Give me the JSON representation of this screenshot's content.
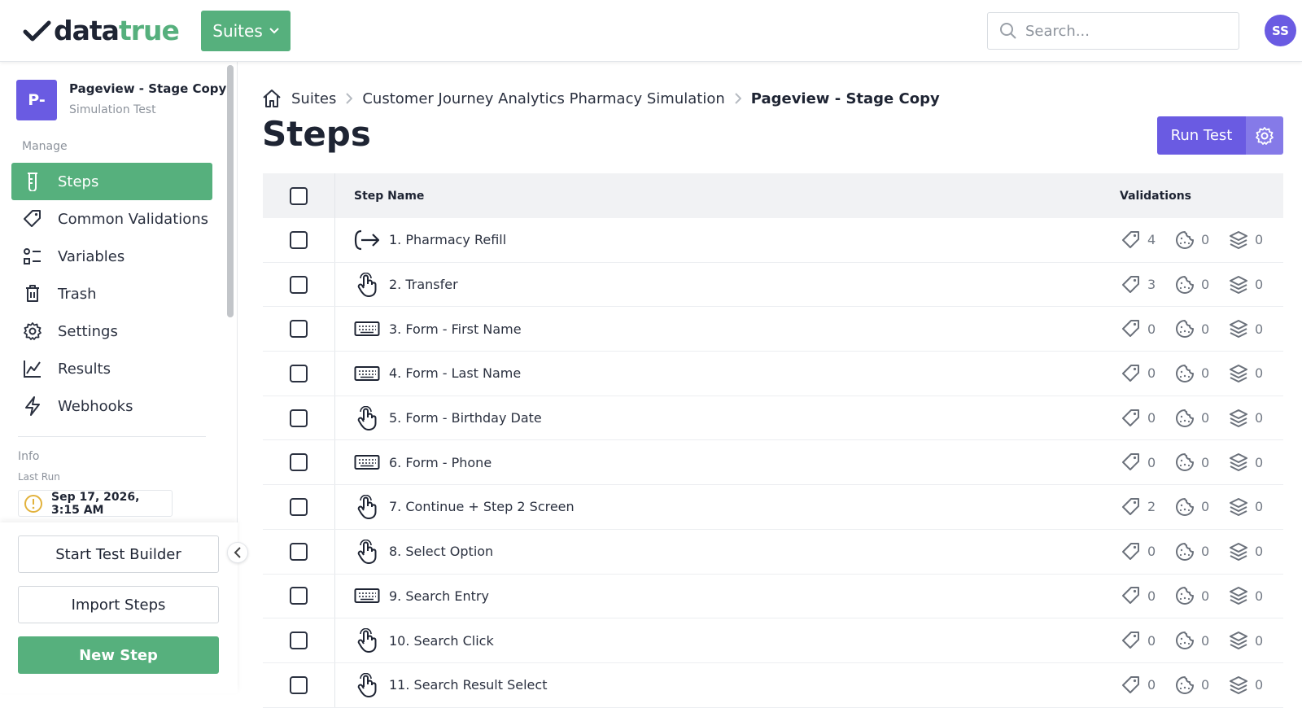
{
  "header": {
    "logo_left": "data",
    "logo_right": "true",
    "suites_label": "Suites",
    "search_placeholder": "Search...",
    "user_initials": "SS"
  },
  "sidebar": {
    "tile": "P-",
    "test_name": "Pageview - Stage Copy",
    "test_type": "Simulation Test",
    "section_label": "Manage",
    "items": [
      {
        "label": "Steps",
        "icon": "beaker-icon",
        "active": true
      },
      {
        "label": "Common Validations",
        "icon": "tag-icon",
        "active": false
      },
      {
        "label": "Variables",
        "icon": "variables-icon",
        "active": false
      },
      {
        "label": "Trash",
        "icon": "trash-icon",
        "active": false
      },
      {
        "label": "Settings",
        "icon": "gear-icon",
        "active": false
      },
      {
        "label": "Results",
        "icon": "chart-icon",
        "active": false
      },
      {
        "label": "Webhooks",
        "icon": "bolt-icon",
        "active": false
      }
    ],
    "info_label": "Info",
    "last_run_label": "Last Run",
    "last_run_value": "Sep 17, 2026, 3:15 AM",
    "buttons": {
      "start_builder": "Start Test Builder",
      "import_steps": "Import Steps",
      "new_step": "New Step"
    }
  },
  "breadcrumb": {
    "home_icon": "home-icon",
    "items": [
      "Suites",
      "Customer Journey Analytics Pharmacy Simulation",
      "Pageview - Stage Copy"
    ]
  },
  "page": {
    "title": "Steps",
    "run_test_label": "Run Test"
  },
  "table": {
    "col_name": "Step Name",
    "col_validations": "Validations",
    "rows": [
      {
        "name": "1. Pharmacy Refill",
        "icon": "navigate-icon",
        "tags": "4",
        "cookies": "0",
        "layers": "0"
      },
      {
        "name": "2. Transfer",
        "icon": "click-icon",
        "tags": "3",
        "cookies": "0",
        "layers": "0"
      },
      {
        "name": "3. Form - First Name",
        "icon": "keyboard-icon",
        "tags": "0",
        "cookies": "0",
        "layers": "0"
      },
      {
        "name": "4. Form - Last Name",
        "icon": "keyboard-icon",
        "tags": "0",
        "cookies": "0",
        "layers": "0"
      },
      {
        "name": "5. Form - Birthday Date",
        "icon": "click-icon",
        "tags": "0",
        "cookies": "0",
        "layers": "0"
      },
      {
        "name": "6. Form - Phone",
        "icon": "keyboard-icon",
        "tags": "0",
        "cookies": "0",
        "layers": "0"
      },
      {
        "name": "7. Continue + Step 2 Screen",
        "icon": "click-icon",
        "tags": "2",
        "cookies": "0",
        "layers": "0"
      },
      {
        "name": "8. Select Option",
        "icon": "click-icon",
        "tags": "0",
        "cookies": "0",
        "layers": "0"
      },
      {
        "name": "9. Search Entry",
        "icon": "keyboard-icon",
        "tags": "0",
        "cookies": "0",
        "layers": "0"
      },
      {
        "name": "10. Search Click",
        "icon": "click-icon",
        "tags": "0",
        "cookies": "0",
        "layers": "0"
      },
      {
        "name": "11. Search Result Select",
        "icon": "click-icon",
        "tags": "0",
        "cookies": "0",
        "layers": "0"
      }
    ]
  },
  "colors": {
    "brand_green": "#56b07d",
    "accent_purple": "#6a5be2",
    "warning_yellow": "#e2b23c"
  }
}
